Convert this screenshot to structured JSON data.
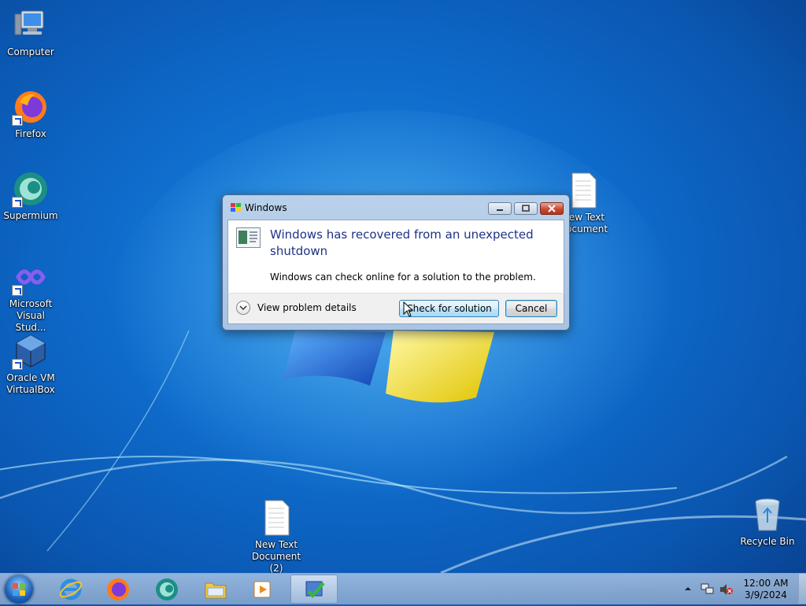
{
  "desktop": {
    "icons": [
      {
        "label": "Computer",
        "icon": "computer-icon"
      },
      {
        "label": "Firefox",
        "icon": "firefox-icon"
      },
      {
        "label": "Supermium",
        "icon": "supermium-icon"
      },
      {
        "label": "Microsoft Visual Stud...",
        "icon": "visual-studio-icon"
      },
      {
        "label": "Oracle VM VirtualBox",
        "icon": "virtualbox-icon"
      },
      {
        "label": "New Text Document",
        "icon": "text-document-icon"
      },
      {
        "label": "New Text Document (2)",
        "icon": "text-document-icon"
      },
      {
        "label": "Recycle Bin",
        "icon": "recycle-bin-icon"
      }
    ]
  },
  "dialog": {
    "title": "Windows",
    "heading": "Windows has recovered from an unexpected shutdown",
    "message": "Windows can check online for a solution to the problem.",
    "details_label": "View problem details",
    "check_button": "Check for solution",
    "cancel_button": "Cancel"
  },
  "taskbar": {
    "pinned": [
      "internet-explorer-icon",
      "firefox-icon",
      "supermium-icon",
      "file-explorer-icon",
      "media-player-icon",
      "action-center-icon"
    ],
    "clock_time": "12:00 AM",
    "clock_date": "3/9/2024"
  },
  "colors": {
    "desktop_blue": "#0f6ccc",
    "heading_blue": "#1e3287",
    "close_red": "#c74a33"
  }
}
